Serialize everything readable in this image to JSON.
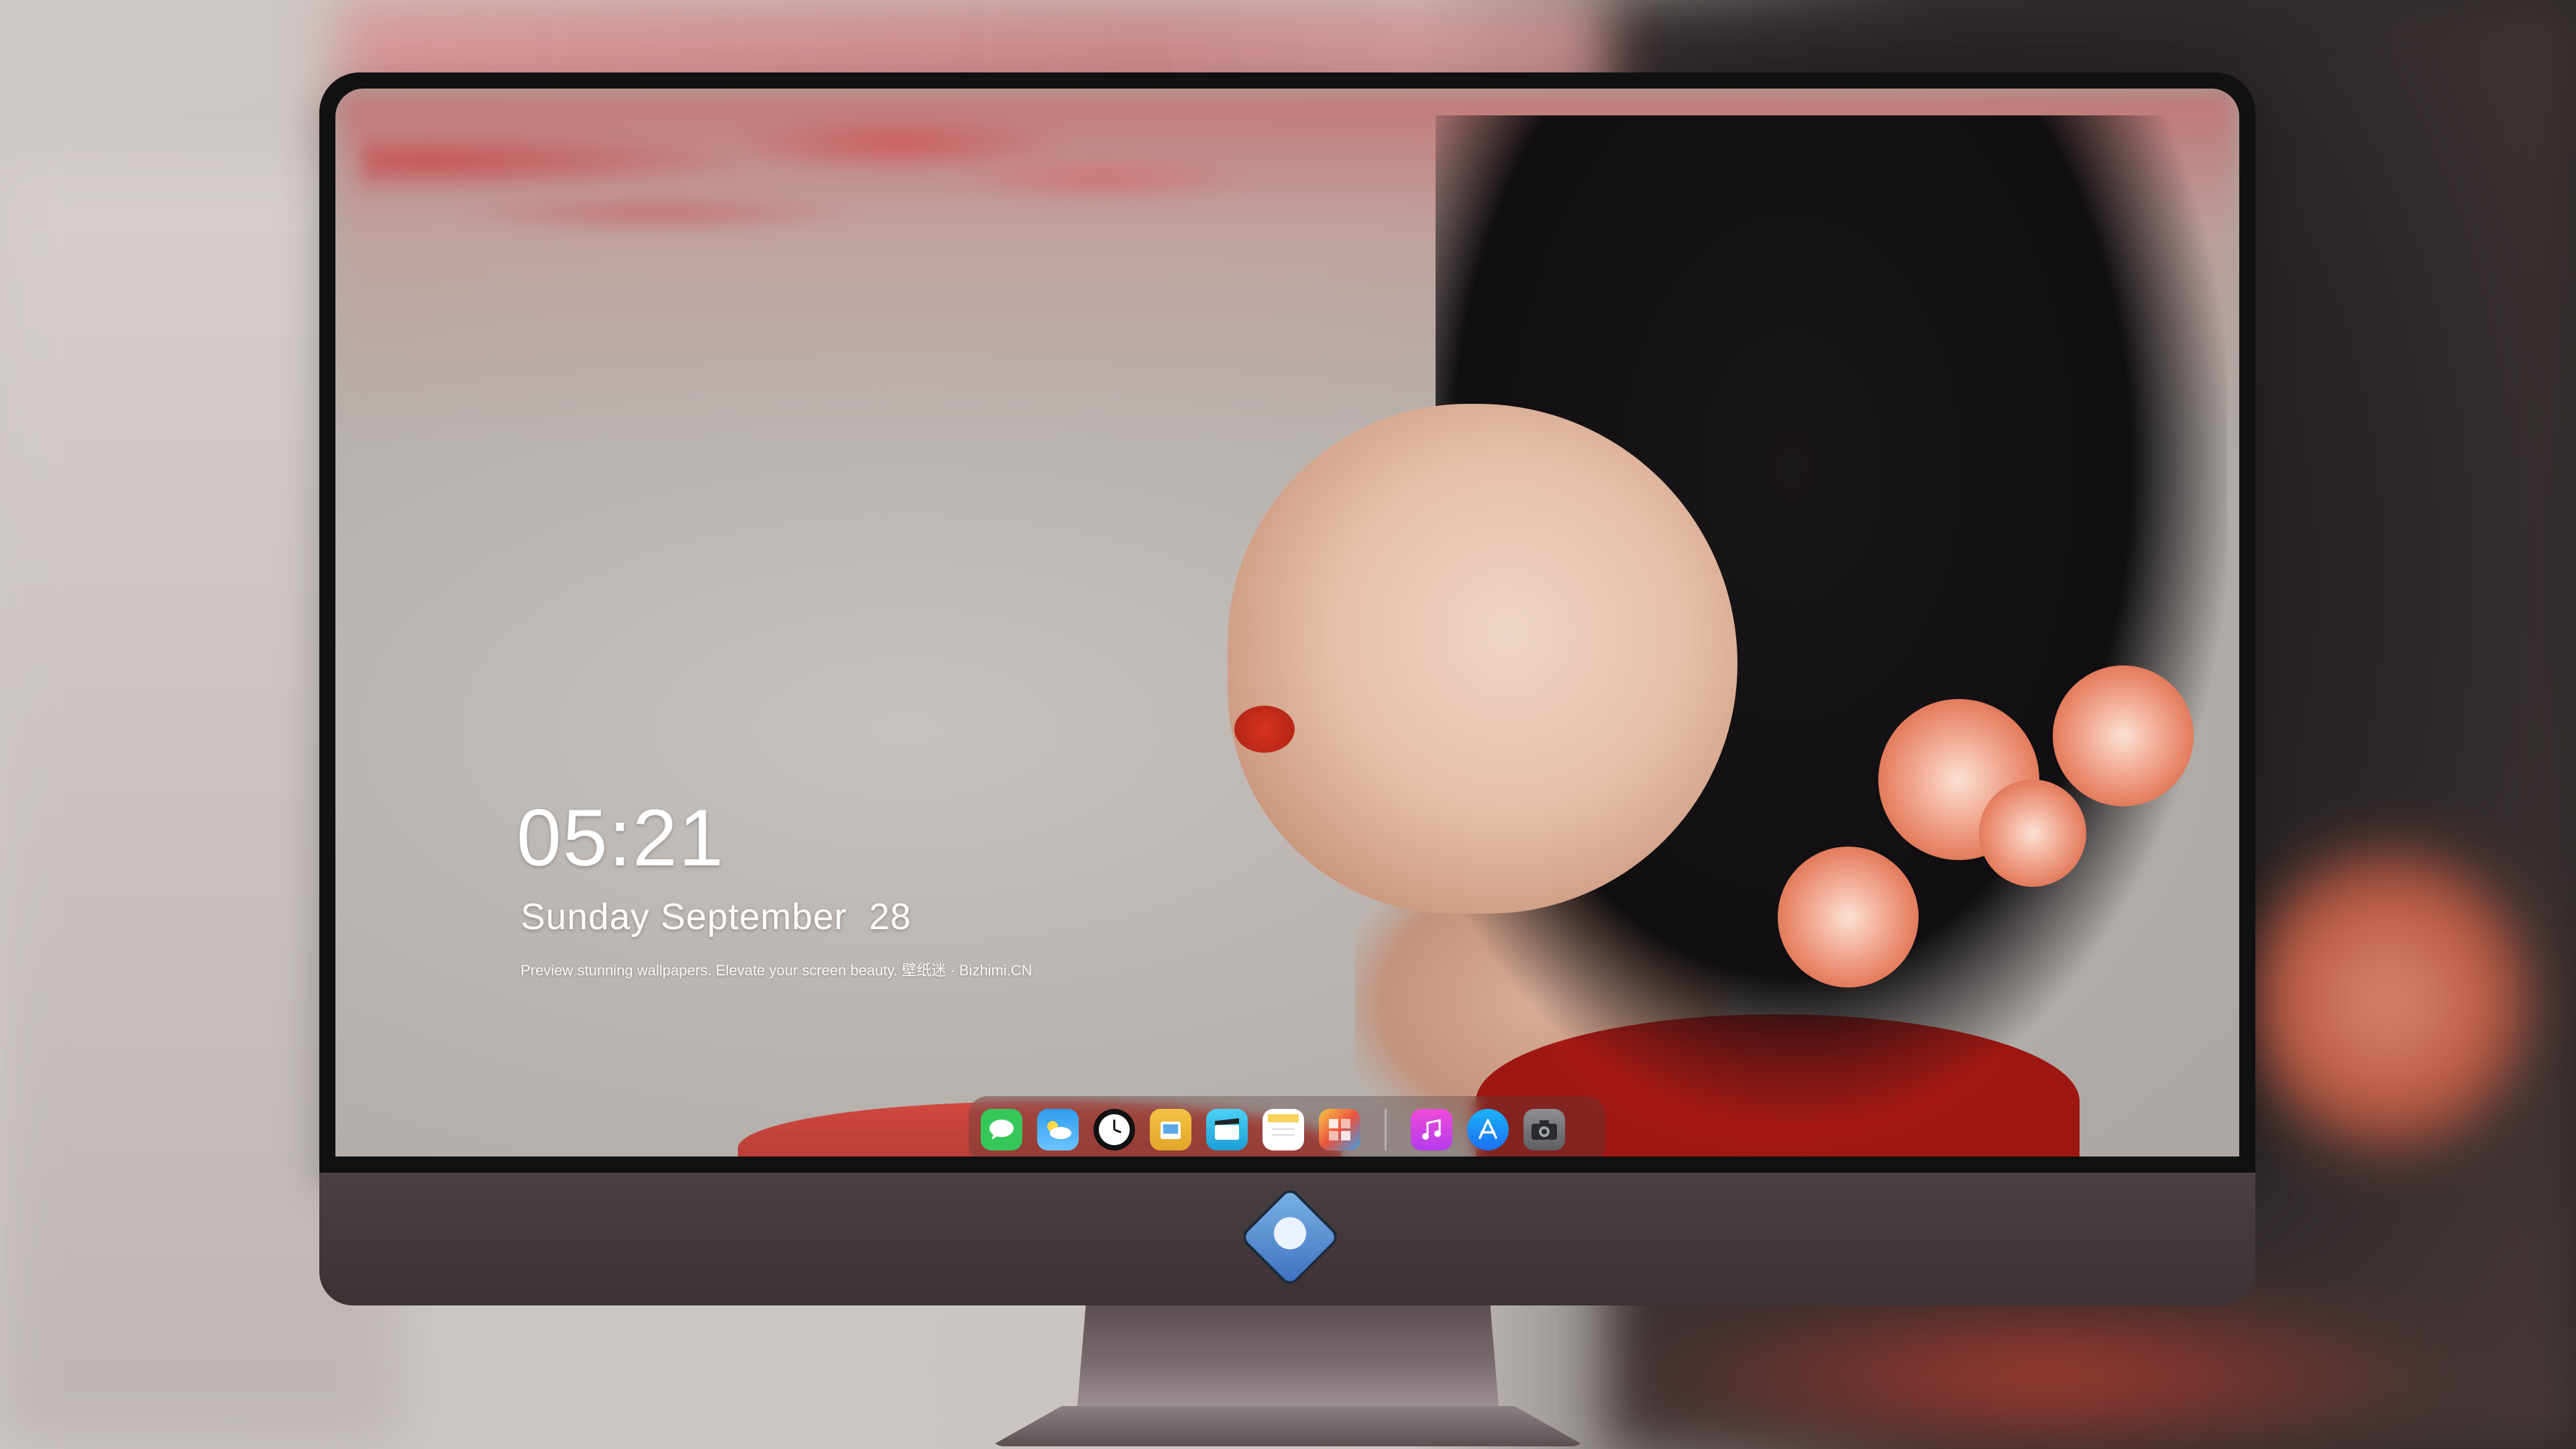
{
  "lockscreen": {
    "time": "05:21",
    "date": "Sunday September  28",
    "tagline": "Preview stunning wallpapers. Elevate your screen beauty. 壁纸迷 · Bizhimi.CN"
  },
  "dock": {
    "apps": [
      {
        "name": "messages-icon",
        "color": "#35c759"
      },
      {
        "name": "weather-icon",
        "color": "#2d9cf0"
      },
      {
        "name": "clock-icon",
        "color": "#111111"
      },
      {
        "name": "preview-icon",
        "color": "#f4c344"
      },
      {
        "name": "clips-icon",
        "color": "#2ab6e8"
      },
      {
        "name": "notes-icon",
        "color": "#f7d35a"
      },
      {
        "name": "photo-booth-icon",
        "color": "#e9533f"
      },
      {
        "name": "itunes-icon",
        "color": "#e24ad9"
      },
      {
        "name": "app-store-icon",
        "color": "#1b8cf2"
      },
      {
        "name": "camera-icon",
        "color": "#5e5e63"
      }
    ]
  },
  "colors": {
    "bezel": "#111111",
    "chin": "#3f3537",
    "text": "#ffffff"
  }
}
